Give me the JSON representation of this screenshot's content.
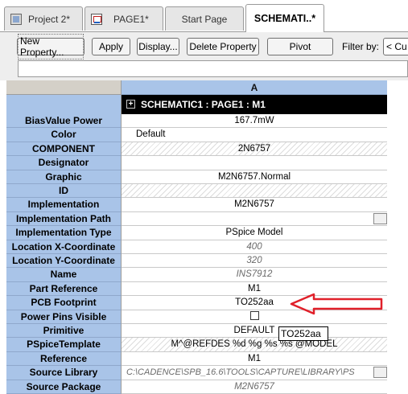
{
  "tabs": [
    {
      "label": "Project 2*",
      "icon": "project-icon"
    },
    {
      "label": "PAGE1*",
      "icon": "schematic-page-icon"
    },
    {
      "label": "Start Page",
      "icon": ""
    },
    {
      "label": "SCHEMATI..*",
      "icon": "",
      "active": true
    }
  ],
  "toolbar": {
    "new_property": "New Property...",
    "apply": "Apply",
    "display": "Display...",
    "delete_property": "Delete Property",
    "pivot": "Pivot",
    "filter_label": "Filter by:",
    "filter_value": "< Cu"
  },
  "grid": {
    "column_header": "A",
    "title": "SCHEMATIC1 : PAGE1 : M1",
    "expand_symbol": "+",
    "rows": [
      {
        "label": "BiasValue Power",
        "value": "167.7mW"
      },
      {
        "label": "Color",
        "value": "Default"
      },
      {
        "label": "COMPONENT",
        "value": "2N6757"
      },
      {
        "label": "Designator",
        "value": ""
      },
      {
        "label": "Graphic",
        "value": "M2N6757.Normal"
      },
      {
        "label": "ID",
        "value": ""
      },
      {
        "label": "Implementation",
        "value": "M2N6757"
      },
      {
        "label": "Implementation Path",
        "value": ""
      },
      {
        "label": "Implementation Type",
        "value": "PSpice Model"
      },
      {
        "label": "Location X-Coordinate",
        "value": "400"
      },
      {
        "label": "Location Y-Coordinate",
        "value": "320"
      },
      {
        "label": "Name",
        "value": "INS7912"
      },
      {
        "label": "Part Reference",
        "value": "M1"
      },
      {
        "label": "PCB Footprint",
        "value": "TO252aa"
      },
      {
        "label": "Power Pins Visible",
        "value": ""
      },
      {
        "label": "Primitive",
        "value": "DEFAULT"
      },
      {
        "label": "PSpiceTemplate",
        "value": "M^@REFDES %d %g %s %s @MODEL"
      },
      {
        "label": "Reference",
        "value": "M1"
      },
      {
        "label": "Source Library",
        "value": "C:\\CADENCE\\SPB_16.6\\TOOLS\\CAPTURE\\LIBRARY\\PS"
      },
      {
        "label": "Source Package",
        "value": "M2N6757"
      }
    ]
  },
  "tooltip": "TO252aa",
  "annotation": {
    "arrow_color": "#e0202a"
  }
}
